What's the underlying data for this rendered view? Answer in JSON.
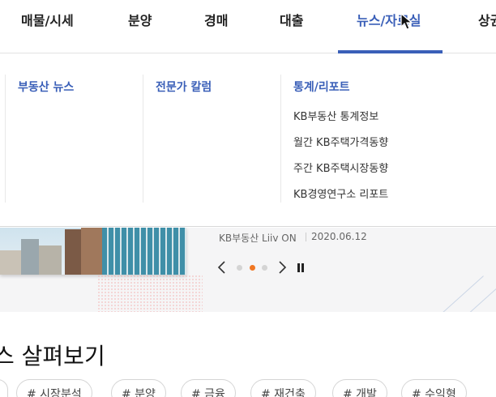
{
  "nav": {
    "items": [
      {
        "label": "매물/시세",
        "active": false
      },
      {
        "label": "분양",
        "active": false
      },
      {
        "label": "경매",
        "active": false
      },
      {
        "label": "대출",
        "active": false
      },
      {
        "label": "뉴스/자료실",
        "active": true
      },
      {
        "label": "상권",
        "active": false
      }
    ]
  },
  "dropdown": {
    "columns": [
      {
        "title": "부동산 뉴스",
        "links": []
      },
      {
        "title": "전문가 칼럼",
        "links": []
      },
      {
        "title": "통계/리포트",
        "links": [
          "KB부동산 통계정보",
          "월간 KB주택가격동향",
          "주간 KB주택시장동향",
          "KB경영연구소 리포트"
        ]
      }
    ]
  },
  "banner": {
    "source": "KB부동산 Liiv ON",
    "date": "2020.06.12",
    "active_slide": 2,
    "slide_count": 3
  },
  "section": {
    "title_fragment": "스 살펴보기",
    "tags": [
      "# 시장분석",
      "# 분양",
      "# 금융",
      "# 재건축",
      "# 개발",
      "# 수익형"
    ]
  },
  "colors": {
    "accent": "#3a5fb8",
    "dot_active": "#f07722"
  }
}
